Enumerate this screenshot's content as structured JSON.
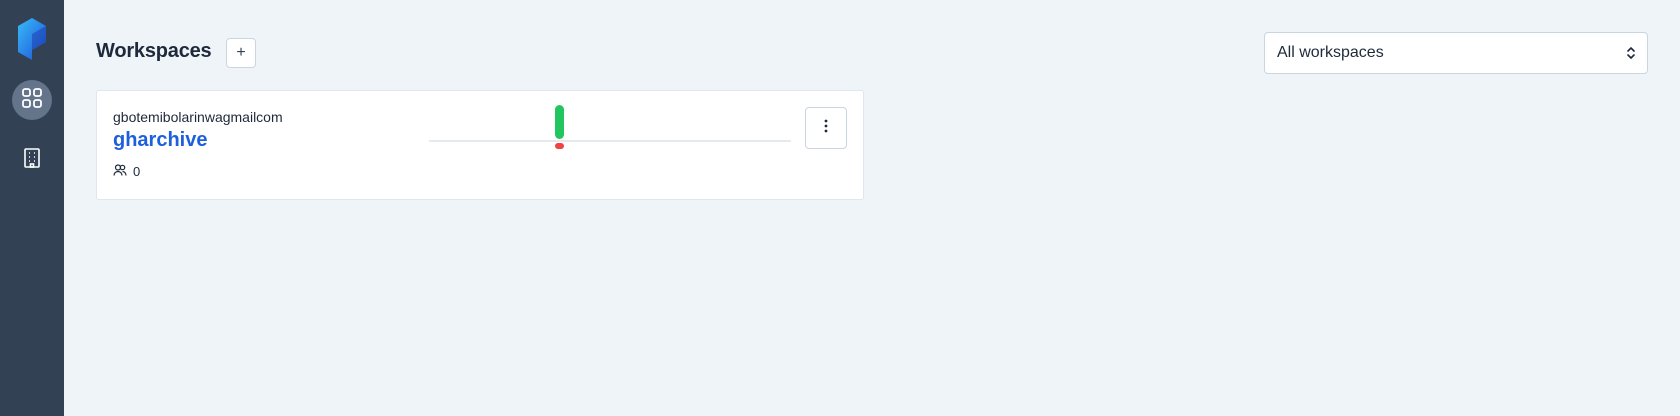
{
  "nav": {
    "logo_icon": "prefect-logo",
    "items": [
      {
        "icon": "grid-icon",
        "active": true
      },
      {
        "icon": "building-icon",
        "active": false
      }
    ]
  },
  "header": {
    "title": "Workspaces",
    "add_label": "+"
  },
  "filter": {
    "selected": "All workspaces"
  },
  "workspaces": [
    {
      "owner": "gbotemibolarinwagmailcom",
      "name": "gharchive",
      "members": "0",
      "activity": {
        "success": 1,
        "failure": 1
      }
    }
  ],
  "colors": {
    "sidebar": "#334155",
    "background": "#eff4f8",
    "link": "#1d5fdc",
    "success": "#22c55e",
    "failure": "#ef4444"
  }
}
